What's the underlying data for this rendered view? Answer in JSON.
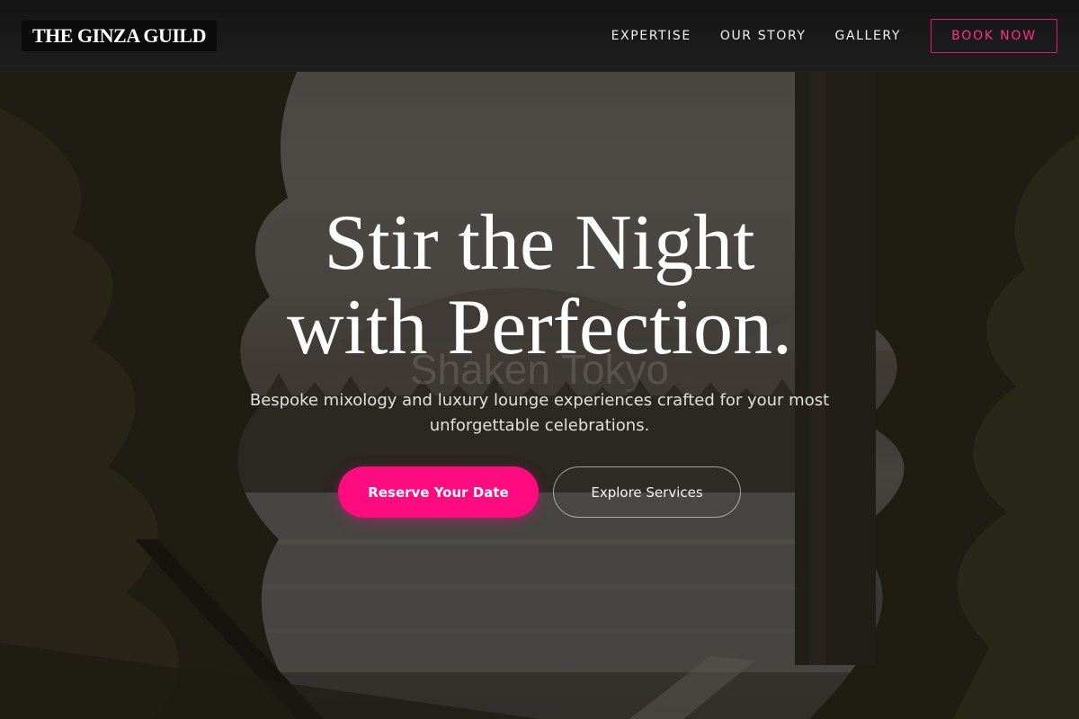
{
  "brand": {
    "name": "THE GINZA GUILD"
  },
  "nav": {
    "links": [
      "EXPERTISE",
      "OUR STORY",
      "GALLERY"
    ],
    "book_label": "BOOK NOW"
  },
  "hero": {
    "headline_line1": "Stir the Night",
    "headline_line2": "with Perfection.",
    "watermark": "Shaken Tokyo",
    "subtitle": "Bespoke mixology and luxury lounge experiences crafted for your most unforgettable celebrations.",
    "primary_cta": "Reserve Your Date",
    "secondary_cta": "Explore Services"
  },
  "colors": {
    "accent": "#ff0b80",
    "nav_background": "#1a1a1a",
    "headline": "#ffffff"
  }
}
